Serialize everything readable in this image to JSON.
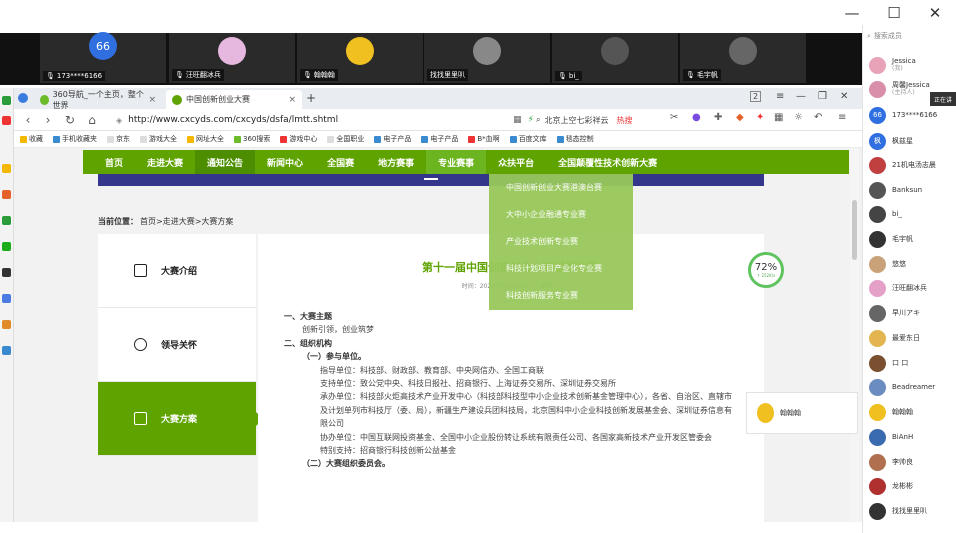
{
  "meeting": {
    "window_controls": [
      "—",
      "☐",
      "✕"
    ],
    "tiles": [
      {
        "name": "173****6166",
        "avatar_text": "66",
        "muted": true
      },
      {
        "name": "汪旺翻冰兵",
        "avatar_text": "",
        "muted": true
      },
      {
        "name": "翰翰翰",
        "avatar_text": "",
        "muted": true
      },
      {
        "name": "找找里里叭",
        "avatar_text": "",
        "muted": false
      },
      {
        "name": "bi_",
        "avatar_text": "",
        "muted": true
      },
      {
        "name": "毛宇帆",
        "avatar_text": "",
        "muted": true
      }
    ]
  },
  "browser": {
    "tabs": [
      {
        "label": "360导航_一个主页，整个世界",
        "active": false
      },
      {
        "label": "中国创新创业大赛",
        "active": true
      }
    ],
    "tab_plus": "+",
    "tab_count": "2",
    "address": "http://www.cxcyds.com/cxcyds/dsfa/lmtt.shtml",
    "search_placeholder": "北京上空七彩祥云",
    "search_hot": "热搜",
    "bookmarks": [
      "收藏",
      "手机收藏夹",
      "京东",
      "游戏大全",
      "网址大全",
      "360搜索",
      "游戏中心",
      "全国职业",
      "电子产品",
      "电子产品",
      "B*血啊",
      "百度文库",
      "毯态控制"
    ]
  },
  "site": {
    "nav": [
      "首页",
      "走进大赛",
      "通知公告",
      "新闻中心",
      "全国赛",
      "地方赛事",
      "专业赛事",
      "众扶平台",
      "全国颠覆性技术创新大赛"
    ],
    "dropdown": [
      "中国创新创业大赛港澳台赛",
      "大中小企业融通专业赛",
      "产业技术创新专业赛",
      "科技计划项目产业化专业赛",
      "科技创新服务专业赛"
    ],
    "breadcrumb": {
      "label": "当前位置：",
      "path": "首页>走进大赛>大赛方案"
    },
    "sidemenu": [
      "大赛介绍",
      "领导关怀",
      "大赛方案"
    ],
    "article": {
      "title": "第十一届中国创新创业大赛组织方案",
      "meta": "时间：2022年04月11日　　来源：",
      "lines": [
        {
          "text": "一、大赛主题",
          "cls": "sec"
        },
        {
          "text": "创新引领，创业筑梦",
          "cls": "indent"
        },
        {
          "text": "二、组织机构",
          "cls": "sec"
        },
        {
          "text": "（一）参与单位。",
          "cls": "indent sec"
        },
        {
          "text": "指导单位：科技部、财政部、教育部、中央网信办、全国工商联",
          "cls": "indent2"
        },
        {
          "text": "支持单位：致公党中央、科技日报社、招商银行、上海证券交易所、深圳证券交易所",
          "cls": "indent2"
        },
        {
          "text": "承办单位：科技部火炬高技术产业开发中心（科技部科技型中小企业技术创新基金管理中心），各省、自治区、直辖市及计划单列市科技厅（委、局），新疆生产建设兵团科技局，北京国科中小企业科技创新发展基金会、深圳证券信息有限公司",
          "cls": "indent2"
        },
        {
          "text": "协办单位：中国互联网投资基金、全国中小企业股份转让系统有限责任公司、各国家高新技术产业开发区管委会",
          "cls": "indent2"
        },
        {
          "text": "特别支持：招商银行科技创新公益基金",
          "cls": "indent2"
        },
        {
          "text": "（二）大赛组织委员会。",
          "cls": "indent sec"
        }
      ]
    },
    "load_circle": {
      "percent": "72%",
      "speed": "↑ 252K/s"
    }
  },
  "floating_speaker": {
    "name": "翰翰翰"
  },
  "participants": {
    "search_placeholder": "搜索成员",
    "talking_label": "正在讲",
    "list": [
      {
        "name": "Jessica",
        "sub": "(我)",
        "color": "#e8a3b8"
      },
      {
        "name": "周馨Jessica",
        "sub": "(主持人)",
        "color": "#d98fa9"
      },
      {
        "name": "173****6166",
        "sub": "",
        "color": "#2f6fe0",
        "avatar_text": "66"
      },
      {
        "name": "枫兹星",
        "sub": "",
        "color": "#2f6fe0",
        "avatar_text": "枫"
      },
      {
        "name": "21机电汤志晨",
        "sub": "",
        "color": "#c04040"
      },
      {
        "name": "Banksun",
        "sub": "",
        "color": "#555555"
      },
      {
        "name": "bi_",
        "sub": "",
        "color": "#444444"
      },
      {
        "name": "毛宇帆",
        "sub": "",
        "color": "#333333"
      },
      {
        "name": "悠悠",
        "sub": "",
        "color": "#c9a27a"
      },
      {
        "name": "汪旺翻冰兵",
        "sub": "",
        "color": "#e5a0c8"
      },
      {
        "name": "早川アキ",
        "sub": "",
        "color": "#666666"
      },
      {
        "name": "最爱东日",
        "sub": "",
        "color": "#e3b550"
      },
      {
        "name": "口 口",
        "sub": "",
        "color": "#7a5030"
      },
      {
        "name": "Beadreamer",
        "sub": "",
        "color": "#6b8cc0"
      },
      {
        "name": "翰翰翰",
        "sub": "",
        "color": "#f0c020"
      },
      {
        "name": "BiAnH",
        "sub": "",
        "color": "#3a6ab0"
      },
      {
        "name": "李帅良",
        "sub": "",
        "color": "#b07050"
      },
      {
        "name": "龙彬彬",
        "sub": "",
        "color": "#b03030"
      },
      {
        "name": "找找里里叭",
        "sub": "",
        "color": "#333333"
      }
    ]
  }
}
